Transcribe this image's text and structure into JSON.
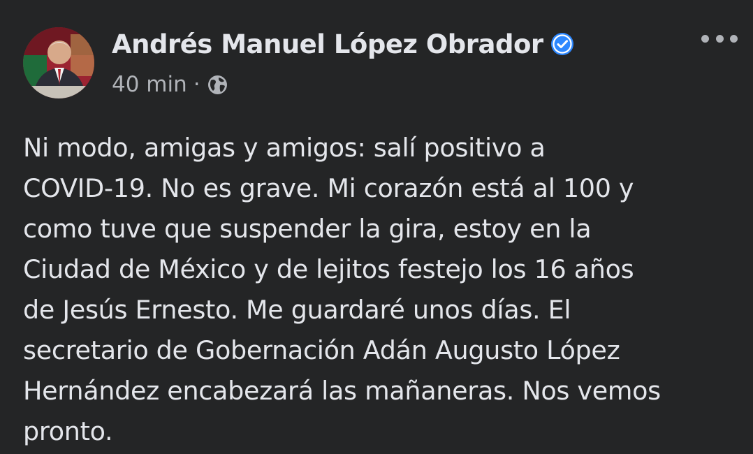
{
  "post": {
    "author": {
      "name": "Andrés Manuel López Obrador",
      "verified": true,
      "avatar_icon": "profile-photo"
    },
    "meta": {
      "time": "40 min",
      "separator": "·",
      "audience_icon": "globe-icon"
    },
    "more_icon": "more-horizontal-icon",
    "text_lines": [
      "Ni modo, amigas y amigos: salí positivo a",
      "COVID-19. No es grave. Mi corazón está al 100 y",
      "como tuve que suspender la gira, estoy en la",
      "Ciudad de México y de lejitos festejo los 16 años",
      "de Jesús Ernesto. Me guardaré unos días. El",
      "secretario de Gobernación Adán Augusto López",
      "Hernández encabezará las mañaneras. Nos vemos",
      "pronto."
    ]
  },
  "colors": {
    "background": "#242526",
    "primary_text": "#e4e6eb",
    "secondary_text": "#b0b3b8",
    "verified_badge": "#2d88ff"
  }
}
